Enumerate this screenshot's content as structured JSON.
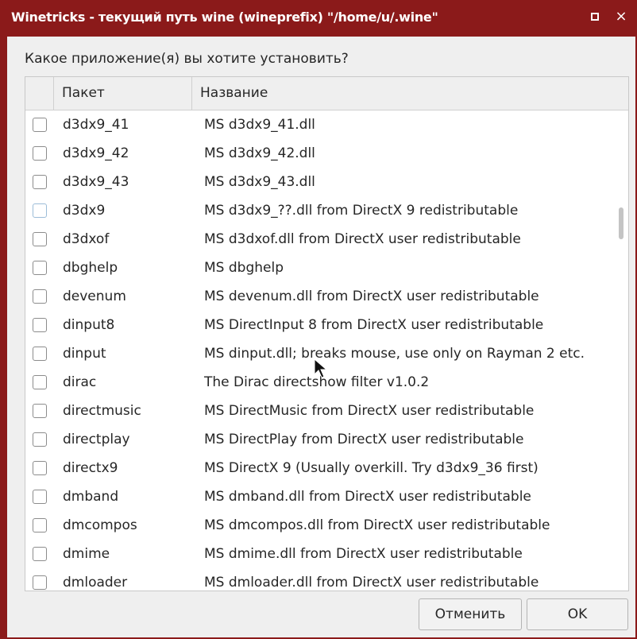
{
  "window": {
    "title": "Winetricks - текущий путь wine (wineprefix) \"/home/u/.wine\"",
    "maximize_icon": "maximize-icon",
    "close_icon": "close-icon",
    "close_glyph": "×"
  },
  "prompt": "Какое приложение(я) вы хотите установить?",
  "columns": {
    "package": "Пакет",
    "name": "Название"
  },
  "rows": [
    {
      "pkg": "d3dx9_41",
      "desc": "MS d3dx9_41.dll"
    },
    {
      "pkg": "d3dx9_42",
      "desc": "MS d3dx9_42.dll"
    },
    {
      "pkg": "d3dx9_43",
      "desc": "MS d3dx9_43.dll"
    },
    {
      "pkg": "d3dx9",
      "desc": "MS d3dx9_??.dll from DirectX 9 redistributable"
    },
    {
      "pkg": "d3dxof",
      "desc": "MS d3dxof.dll from DirectX user redistributable"
    },
    {
      "pkg": "dbghelp",
      "desc": "MS dbghelp"
    },
    {
      "pkg": "devenum",
      "desc": "MS devenum.dll from DirectX user redistributable"
    },
    {
      "pkg": "dinput8",
      "desc": "MS DirectInput 8 from DirectX user redistributable"
    },
    {
      "pkg": "dinput",
      "desc": "MS dinput.dll; breaks mouse, use only on Rayman 2 etc."
    },
    {
      "pkg": "dirac",
      "desc": "The Dirac directshow filter v1.0.2"
    },
    {
      "pkg": "directmusic",
      "desc": "MS DirectMusic from DirectX user redistributable"
    },
    {
      "pkg": "directplay",
      "desc": "MS DirectPlay from DirectX user redistributable"
    },
    {
      "pkg": "directx9",
      "desc": "MS DirectX 9 (Usually overkill.  Try d3dx9_36 first)"
    },
    {
      "pkg": "dmband",
      "desc": "MS dmband.dll from DirectX user redistributable"
    },
    {
      "pkg": "dmcompos",
      "desc": "MS dmcompos.dll from DirectX user redistributable"
    },
    {
      "pkg": "dmime",
      "desc": "MS dmime.dll from DirectX user redistributable"
    },
    {
      "pkg": "dmloader",
      "desc": "MS dmloader.dll from DirectX user redistributable"
    }
  ],
  "buttons": {
    "cancel": "Отменить",
    "ok": "OK"
  },
  "colors": {
    "titlebar": "#8b1a1a",
    "background": "#efefef"
  }
}
